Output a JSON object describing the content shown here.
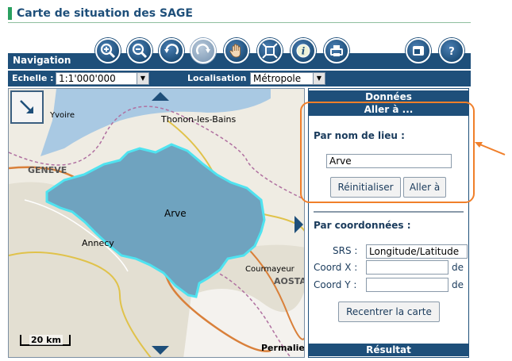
{
  "header": {
    "title": "Carte de situation des SAGE"
  },
  "navigation": {
    "label": "Navigation",
    "tools": [
      "zoom-in-icon",
      "zoom-out-icon",
      "undo-icon",
      "redo-icon",
      "pan-hand-icon",
      "full-extent-icon",
      "info-icon",
      "print-icon",
      "window-icon",
      "help-icon"
    ]
  },
  "controls": {
    "scale_label": "Echelle :",
    "scale_value": "1:1'000'000",
    "location_label": "Localisation :",
    "location_value": "Métropole"
  },
  "map": {
    "sage_label": "Arve",
    "scalebar_label": "20 km",
    "permalink_label": "Permalien",
    "place_labels": [
      "Yvoire",
      "Thonon-les-Bains",
      "Annecy",
      "GENEVE",
      "AOSTA",
      "Courmayeur"
    ]
  },
  "panel": {
    "data_header": "Données",
    "goto_header": "Aller à ...",
    "by_name_title": "Par nom de lieu :",
    "name_value": "Arve",
    "reset_label": "Réinitialiser",
    "go_label": "Aller à",
    "by_coords_title": "Par coordonnées :",
    "srs_label": "SRS :",
    "srs_value": "Longitude/Latitude",
    "coord_x_label": "Coord X :",
    "coord_y_label": "Coord Y :",
    "coord_x_unit": "de",
    "coord_y_unit": "de",
    "recenter_label": "Recentrer la carte",
    "result_header": "Résultat"
  },
  "colors": {
    "brand_blue": "#1e4f7a",
    "sage_fill": "#6fa3bf",
    "sage_outline": "#4fe3f0",
    "annotation": "#f07f2a"
  }
}
